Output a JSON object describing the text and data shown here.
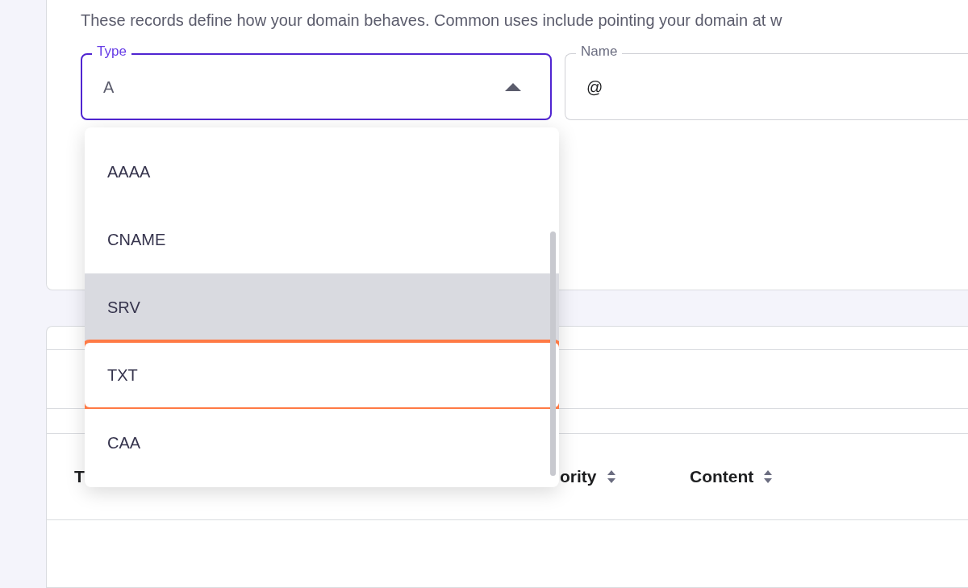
{
  "description": "These records define how your domain behaves. Common uses include pointing your domain at w",
  "type_field": {
    "label": "Type",
    "value": "A",
    "expanded": true
  },
  "name_field": {
    "label": "Name",
    "value": "@"
  },
  "type_options": [
    {
      "label": "AAAA",
      "hovered": false,
      "highlighted": false
    },
    {
      "label": "CNAME",
      "hovered": false,
      "highlighted": false
    },
    {
      "label": "SRV",
      "hovered": true,
      "highlighted": false
    },
    {
      "label": "TXT",
      "hovered": false,
      "highlighted": true
    },
    {
      "label": "CAA",
      "hovered": false,
      "highlighted": false
    }
  ],
  "table": {
    "columns": [
      {
        "label": "T"
      },
      {
        "label": "ority",
        "sortable": true
      },
      {
        "label": "Content",
        "sortable": true
      }
    ]
  }
}
